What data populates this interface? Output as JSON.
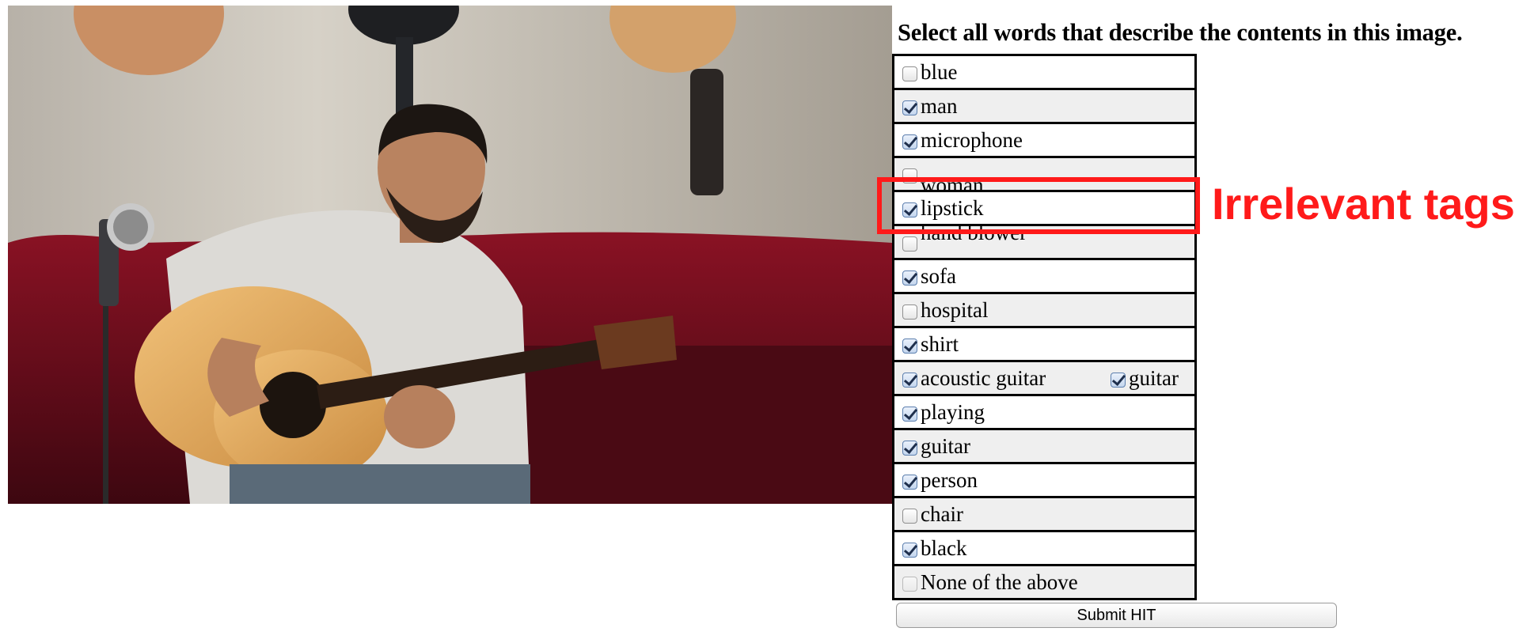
{
  "question": "Select all words that describe the contents in this image.",
  "tags": [
    {
      "label": "blue",
      "checked": false
    },
    {
      "label": "man",
      "checked": true
    },
    {
      "label": "microphone",
      "checked": true
    },
    {
      "label": "woman",
      "checked": false
    },
    {
      "label": "lipstick",
      "checked": true
    },
    {
      "label": "hand blower",
      "checked": false
    },
    {
      "label": "sofa",
      "checked": true
    },
    {
      "label": "hospital",
      "checked": false
    },
    {
      "label": "shirt",
      "checked": true
    },
    {
      "label": "acoustic guitar",
      "checked": true,
      "extra": {
        "label": "guitar",
        "checked": true
      }
    },
    {
      "label": "playing",
      "checked": true
    },
    {
      "label": "guitar",
      "checked": true
    },
    {
      "label": "person",
      "checked": true
    },
    {
      "label": "chair",
      "checked": false
    },
    {
      "label": "black",
      "checked": true
    },
    {
      "label": "None of the above",
      "checked": false
    }
  ],
  "annotation": {
    "label": "Irrelevant tags",
    "color": "#ff1a1a"
  },
  "submit_label": "Submit HIT"
}
